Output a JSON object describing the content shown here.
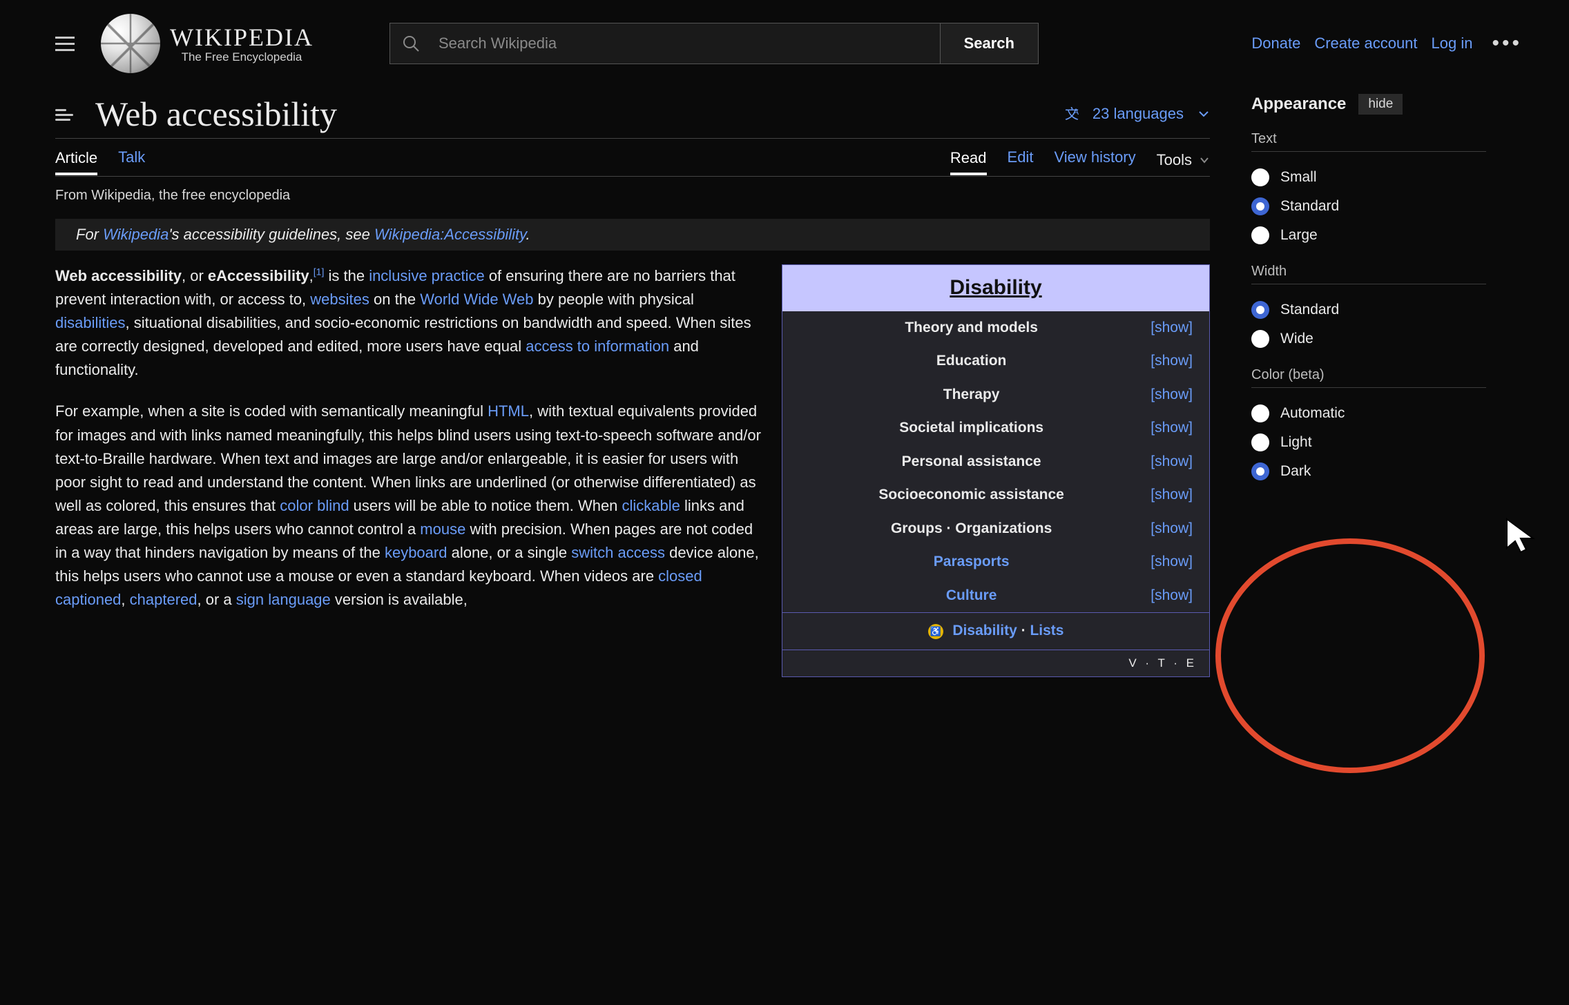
{
  "header": {
    "site_title": "WIKIPEDIA",
    "site_subtitle": "The Free Encyclopedia",
    "search_placeholder": "Search Wikipedia",
    "search_button": "Search",
    "links": {
      "donate": "Donate",
      "create_account": "Create account",
      "log_in": "Log in"
    }
  },
  "article": {
    "title": "Web accessibility",
    "language_count": "23 languages",
    "tabs_left": {
      "article": "Article",
      "talk": "Talk"
    },
    "tabs_right": {
      "read": "Read",
      "edit": "Edit",
      "history": "View history",
      "tools": "Tools"
    },
    "tagline": "From Wikipedia, the free encyclopedia",
    "hatnote": {
      "pre": "For ",
      "link1": "Wikipedia",
      "mid": "'s accessibility guidelines, see ",
      "link2": "Wikipedia:Accessibility",
      "post": "."
    },
    "para1": {
      "bold1": "Web accessibility",
      "t1": ", or ",
      "bold2": "eAccessibility",
      "t2": ",",
      "sup": "[1]",
      "t3": " is the ",
      "link_inclusive": "inclusive practice",
      "t4": " of ensuring there are no barriers that prevent interaction with, or access to, ",
      "link_websites": "websites",
      "t5": " on the ",
      "link_www": "World Wide Web",
      "t6": " by people with physical ",
      "link_disabilities": "disabilities",
      "t7": ", situational disabilities, and socio-economic restrictions on bandwidth and speed. When sites are correctly designed, developed and edited, more users have equal ",
      "link_access": "access to information",
      "t8": " and functionality."
    },
    "para2": {
      "t1": "For example, when a site is coded with semantically meaningful ",
      "link_html": "HTML",
      "t2": ", with textual equivalents provided for images and with links named meaningfully, this helps blind users using text-to-speech software and/or text-to-Braille hardware. When text and images are large and/or enlargeable, it is easier for users with poor sight to read and understand the content. When links are underlined (or otherwise differentiated) as well as colored, this ensures that ",
      "link_colorblind": "color blind",
      "t3": " users will be able to notice them. When ",
      "link_clickable": "clickable",
      "t4": " links and areas are large, this helps users who cannot control a ",
      "link_mouse": "mouse",
      "t5": " with precision. When pages are not coded in a way that hinders navigation by means of the ",
      "link_keyboard": "keyboard",
      "t6": " alone, or a single ",
      "link_switch": "switch access",
      "t7": " device alone, this helps users who cannot use a mouse or even a standard keyboard. When videos are ",
      "link_cc": "closed captioned",
      "t8": ", ",
      "link_chaptered": "chaptered",
      "t9": ", or a ",
      "link_signlang": "sign language",
      "t10": " version is available,"
    }
  },
  "infobox": {
    "title": "Disability",
    "rows": [
      {
        "label": "Theory and models",
        "link": false
      },
      {
        "label": "Education",
        "link": false
      },
      {
        "label": "Therapy",
        "link": false
      },
      {
        "label": "Societal implications",
        "link": false
      },
      {
        "label": "Personal assistance",
        "link": false
      },
      {
        "label": "Socioeconomic assistance",
        "link": false
      },
      {
        "label": "Groups · Organizations",
        "link": false
      },
      {
        "label": "Parasports",
        "link": true
      },
      {
        "label": "Culture",
        "link": true
      }
    ],
    "show_label": "show",
    "footer_disability": "Disability",
    "footer_sep": " · ",
    "footer_lists": "Lists",
    "vte": "V · T · E"
  },
  "appearance": {
    "heading": "Appearance",
    "hide": "hide",
    "groups": {
      "text": {
        "title": "Text",
        "options": [
          {
            "label": "Small",
            "selected": false
          },
          {
            "label": "Standard",
            "selected": true
          },
          {
            "label": "Large",
            "selected": false
          }
        ]
      },
      "width": {
        "title": "Width",
        "options": [
          {
            "label": "Standard",
            "selected": true
          },
          {
            "label": "Wide",
            "selected": false
          }
        ]
      },
      "color": {
        "title": "Color (beta)",
        "options": [
          {
            "label": "Automatic",
            "selected": false
          },
          {
            "label": "Light",
            "selected": false
          },
          {
            "label": "Dark",
            "selected": true
          }
        ]
      }
    }
  }
}
